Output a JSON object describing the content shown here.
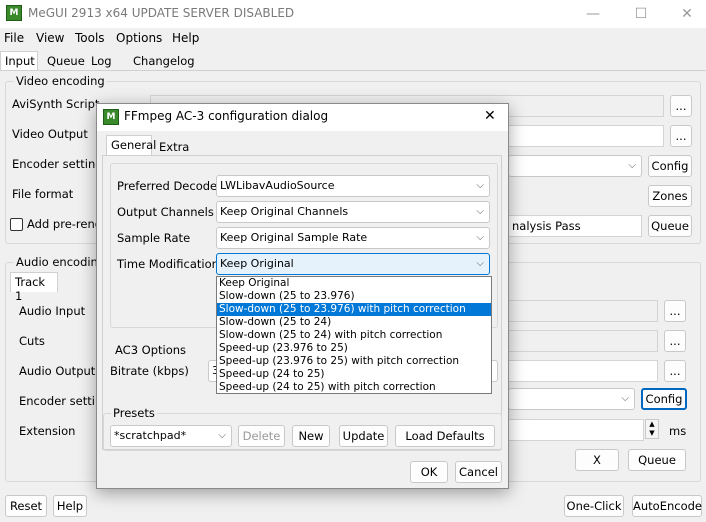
{
  "window": {
    "title": "MeGUI 2913 x64 UPDATE SERVER DISABLED",
    "icon": "megui-logo-icon"
  },
  "menu": [
    "File",
    "View",
    "Tools",
    "Options",
    "Help"
  ],
  "main_tabs": [
    "Input",
    "Queue",
    "Log",
    "Changelog"
  ],
  "video": {
    "group_label": "Video encoding",
    "avisynth_label": "AviSynth Script",
    "output_label": "Video Output",
    "encoder_label": "Encoder settings",
    "format_label": "File format",
    "add_pre_label": "Add pre-rende",
    "analysis_text": "nalysis Pass",
    "config_btn": "Config",
    "zones_btn": "Zones",
    "queue_btn": "Queue",
    "browse_btn": "..."
  },
  "audio": {
    "group_label": "Audio encoding",
    "track_tab": "Track 1",
    "input_label": "Audio Input",
    "cuts_label": "Cuts",
    "output_label": "Audio Output",
    "encoder_label": "Encoder setting",
    "extension_label": "Extension",
    "config_btn": "Config",
    "ms_label": "ms",
    "x_btn": "X",
    "queue_btn": "Queue",
    "browse_btn": "..."
  },
  "bottom": {
    "reset": "Reset",
    "help": "Help",
    "oneclick": "One-Click",
    "autoencode": "AutoEncode"
  },
  "dialog": {
    "title": "FFmpeg AC-3 configuration dialog",
    "close": "✕",
    "tabs": [
      "General",
      "Extra"
    ],
    "preferred_decoder_label": "Preferred Decoder",
    "preferred_decoder_value": "LWLibavAudioSource",
    "output_channels_label": "Output Channels",
    "output_channels_value": "Keep Original Channels",
    "sample_rate_label": "Sample Rate",
    "sample_rate_value": "Keep Original Sample Rate",
    "time_mod_label": "Time Modification",
    "time_mod_value": "Keep Original",
    "time_mod_options": [
      "Keep Original",
      "Slow-down (25 to 23.976)",
      "Slow-down (25 to 23.976) with pitch correction",
      "Slow-down (25 to 24)",
      "Slow-down (25 to 24) with pitch correction",
      "Speed-up (23.976 to 25)",
      "Speed-up (23.976 to 25) with pitch correction",
      "Speed-up (24 to 25)",
      "Speed-up (24 to 25) with pitch correction"
    ],
    "highlighted_option_index": 2,
    "ac3_group": "AC3 Options",
    "bitrate_label": "Bitrate (kbps)",
    "bitrate_value": "3",
    "presets_group": "Presets",
    "preset_value": "*scratchpad*",
    "delete_btn": "Delete",
    "new_btn": "New",
    "update_btn": "Update",
    "load_defaults_btn": "Load Defaults",
    "ok_btn": "OK",
    "cancel_btn": "Cancel"
  }
}
